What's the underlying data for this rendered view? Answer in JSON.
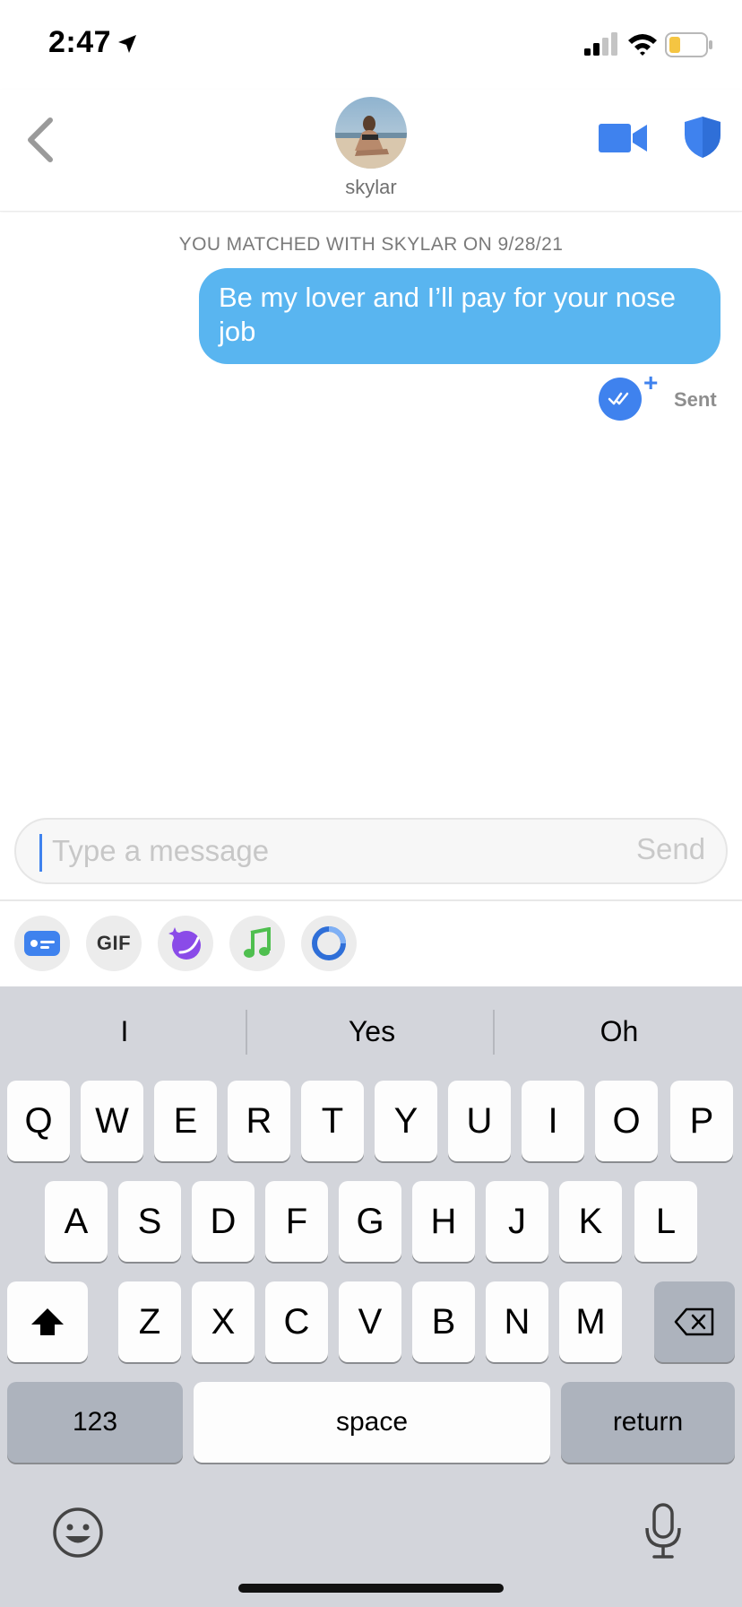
{
  "status_bar": {
    "time": "2:47"
  },
  "header": {
    "match_name": "skylar"
  },
  "conversation": {
    "match_date": "YOU MATCHED WITH SKYLAR ON 9/28/21",
    "messages": [
      {
        "text": "Be my lover and I’ll pay for your nose job",
        "status": "Sent"
      }
    ]
  },
  "composer": {
    "placeholder": "Type a message",
    "send_label": "Send"
  },
  "tools": {
    "gif_label": "GIF"
  },
  "keyboard": {
    "suggestions": [
      "I",
      "Yes",
      "Oh"
    ],
    "row1": [
      "Q",
      "W",
      "E",
      "R",
      "T",
      "Y",
      "U",
      "I",
      "O",
      "P"
    ],
    "row2": [
      "A",
      "S",
      "D",
      "F",
      "G",
      "H",
      "J",
      "K",
      "L"
    ],
    "row3": [
      "Z",
      "X",
      "C",
      "V",
      "B",
      "N",
      "M"
    ],
    "numbers_label": "123",
    "space_label": "space",
    "return_label": "return"
  },
  "colors": {
    "accent_blue": "#3f82ee",
    "bubble_blue": "#59b5f0",
    "keyboard_bg": "#d3d5db"
  },
  "icons": [
    "location-arrow-icon",
    "signal-icon",
    "wifi-icon",
    "battery-icon",
    "back-chevron-icon",
    "video-call-icon",
    "shield-icon",
    "read-receipt-icon",
    "id-card-icon",
    "sticker-icon",
    "music-note-icon",
    "circle-ring-icon",
    "shift-icon",
    "backspace-icon",
    "emoji-icon",
    "microphone-icon"
  ]
}
